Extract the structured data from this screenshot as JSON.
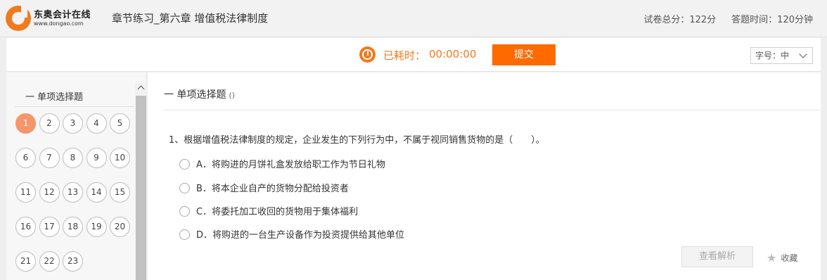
{
  "header": {
    "logo_cn": "东奥会计在线",
    "logo_en": "www.dongao.com",
    "title": "章节练习_第六章 增值税法律制度",
    "total_score": "试卷总分：122分",
    "answer_time": "答题时间：120分钟"
  },
  "toolbar": {
    "timer_icon": "stopwatch-icon",
    "timer_label": "已耗时：",
    "timer_value": "00:00:00",
    "submit_label": "提交",
    "font_size_label": "字号：中",
    "accent_color": "#f07a1e",
    "submit_color": "#ff6a00"
  },
  "sidebar": {
    "section_title": "一 单项选择题",
    "numbers": [
      "1",
      "2",
      "3",
      "4",
      "5",
      "6",
      "7",
      "8",
      "9",
      "10",
      "11",
      "12",
      "13",
      "14",
      "15",
      "16",
      "17",
      "18",
      "19",
      "20",
      "21",
      "22",
      "23"
    ],
    "active_number": "1"
  },
  "main": {
    "section_title": "一 单项选择题",
    "section_count": "()",
    "question": "1、根据增值税法律制度的规定，企业发生的下列行为中，不属于视同销售货物的是（　　）。",
    "options": [
      "A．将购进的月饼礼盒发放给职工作为节日礼物",
      "B．将本企业自产的货物分配给投资者",
      "C．将委托加工收回的货物用于集体福利",
      "D．将购进的一台生产设备作为投资提供给其他单位"
    ],
    "analysis_label": "查看解析",
    "favorite_label": "收藏"
  }
}
